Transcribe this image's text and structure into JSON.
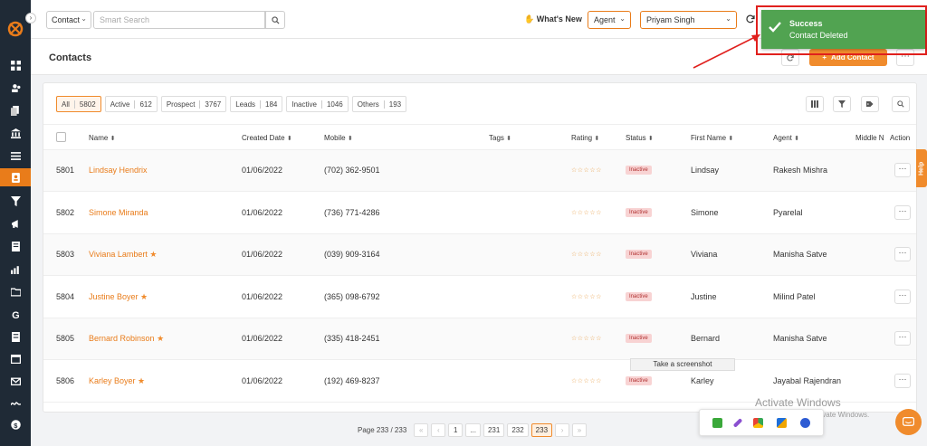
{
  "header": {
    "context_select": "Contact",
    "search_placeholder": "Smart Search",
    "whats_new": "What's New",
    "role_select": "Agent",
    "user_select": "Priyam Singh"
  },
  "page": {
    "title": "Contacts",
    "add_button": "Add Contact"
  },
  "filters": [
    {
      "label": "All",
      "count": "5802",
      "active": true
    },
    {
      "label": "Active",
      "count": "612"
    },
    {
      "label": "Prospect",
      "count": "3767"
    },
    {
      "label": "Leads",
      "count": "184"
    },
    {
      "label": "Inactive",
      "count": "1046"
    },
    {
      "label": "Others",
      "count": "193"
    }
  ],
  "columns": [
    "Name",
    "Created Date",
    "Mobile",
    "Tags",
    "Rating",
    "Status",
    "First Name",
    "Agent",
    "Middle N",
    "Action"
  ],
  "rows": [
    {
      "id": "5801",
      "name": "Lindsay Hendrix",
      "starred": false,
      "created": "01/06/2022",
      "mobile": "(702) 362-9501",
      "status": "Inactive",
      "first_name": "Lindsay",
      "agent": "Rakesh Mishra"
    },
    {
      "id": "5802",
      "name": "Simone Miranda",
      "starred": false,
      "created": "01/06/2022",
      "mobile": "(736) 771-4286",
      "status": "Inactive",
      "first_name": "Simone",
      "agent": "Pyarelal"
    },
    {
      "id": "5803",
      "name": "Viviana Lambert",
      "starred": true,
      "created": "01/06/2022",
      "mobile": "(039) 909-3164",
      "status": "Inactive",
      "first_name": "Viviana",
      "agent": "Manisha Satve"
    },
    {
      "id": "5804",
      "name": "Justine Boyer",
      "starred": true,
      "created": "01/06/2022",
      "mobile": "(365) 098-6792",
      "status": "Inactive",
      "first_name": "Justine",
      "agent": "Milind Patel"
    },
    {
      "id": "5805",
      "name": "Bernard Robinson",
      "starred": true,
      "created": "01/06/2022",
      "mobile": "(335) 418-2451",
      "status": "Inactive",
      "first_name": "Bernard",
      "agent": "Manisha Satve"
    },
    {
      "id": "5806",
      "name": "Karley Boyer",
      "starred": true,
      "created": "01/06/2022",
      "mobile": "(192) 469-8237",
      "status": "Inactive",
      "first_name": "Karley",
      "agent": "Jayabal Rajendran"
    }
  ],
  "pagination": {
    "label": "Page 233 / 233",
    "first": "«",
    "prev": "‹",
    "pages": [
      "1",
      "...",
      "231",
      "232",
      "233"
    ],
    "current": "233",
    "next": "›",
    "last": "»"
  },
  "toast": {
    "title": "Success",
    "message": "Contact Deleted"
  },
  "help_tab": "Help",
  "tooltip": "Take a screenshot",
  "watermark": {
    "title": "Activate Windows",
    "subtitle": "Go to Settings to activate Windows."
  },
  "colors": {
    "accent": "#f08b2c",
    "sidebar": "#1f2a36",
    "toast": "#51a351",
    "status_bg": "#f8d3d3"
  }
}
